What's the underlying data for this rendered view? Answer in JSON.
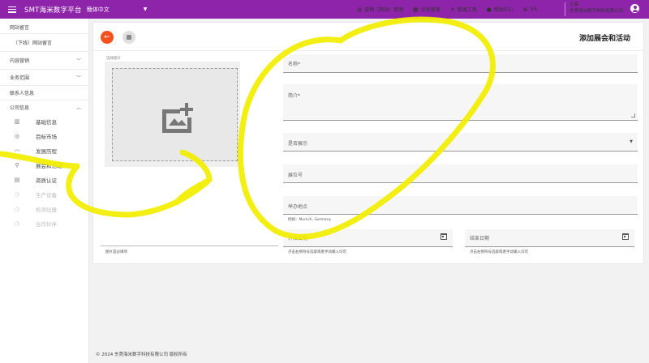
{
  "topbar": {
    "brand": "SMT海米数字平台",
    "language": "簡体中文",
    "nav": [
      {
        "icon": "globe-icon",
        "label": "营销（网站）管理"
      },
      {
        "icon": "business-icon",
        "label": "业务管理"
      },
      {
        "icon": "tools-icon",
        "label": "管理工具"
      },
      {
        "icon": "help-icon",
        "label": "帮助中心"
      },
      {
        "icon": "translate-icon",
        "label": "SA"
      }
    ],
    "user_name": "王森",
    "user_company": "东莞海米数字科技有限公司"
  },
  "sidebar": {
    "sections": [
      {
        "label": "网站留言"
      },
      {
        "label": "（下线）网站留言"
      },
      {
        "label": "内容营销"
      },
      {
        "label": "业务范围"
      },
      {
        "label": "联系人信息"
      },
      {
        "label": "公司信息"
      }
    ],
    "items": [
      {
        "icon": "building-icon",
        "label": "基础信息"
      },
      {
        "icon": "target-icon",
        "label": "目标市场"
      },
      {
        "icon": "trend-icon",
        "label": "发展历程"
      },
      {
        "icon": "location-icon",
        "label": "展会和活动"
      },
      {
        "icon": "certificate-icon",
        "label": "资质认证"
      },
      {
        "icon": "history-icon",
        "label": "生产设备"
      },
      {
        "icon": "history-icon",
        "label": "检测仪器"
      },
      {
        "icon": "history-icon",
        "label": "合作伙伴"
      }
    ]
  },
  "main": {
    "title": "添加展会和活动",
    "image_label": "选择图片",
    "image_hint": "图片是必填项",
    "fields": {
      "name": "名称*",
      "intro": "简介*",
      "show": "是否展示",
      "booth": "展位号",
      "venue": "举办地点",
      "venue_hint": "例如：Munich, Germany",
      "start_date": "开始日期",
      "start_hint": "点击右侧符号选取或者手动输入均可",
      "end_date": "结束日期",
      "end_hint": "点击右侧符号选取或者手动输入均可"
    }
  },
  "footer": "© 2024 东莞海米数字科技有限公司 版权所有",
  "colors": {
    "header": "#8e24aa",
    "back_button": "#f4511e",
    "highlight": "#f5f000"
  }
}
